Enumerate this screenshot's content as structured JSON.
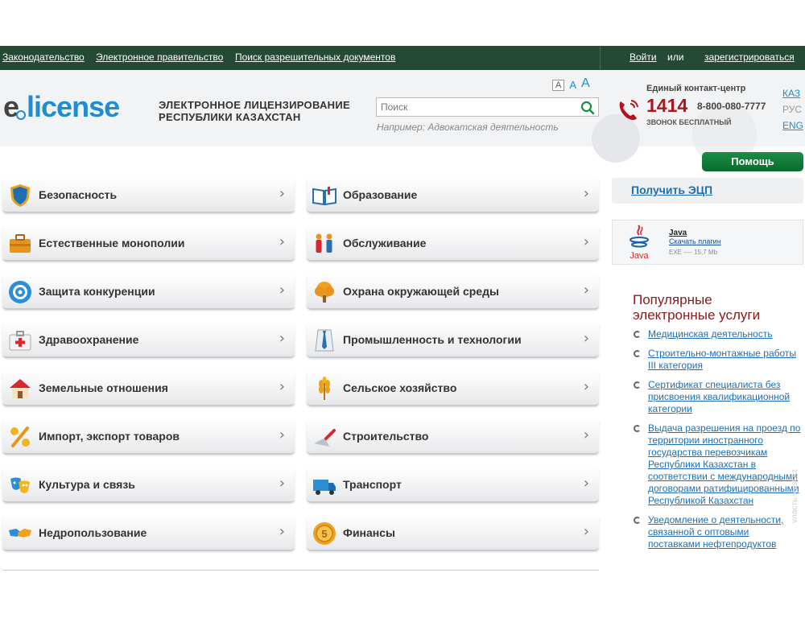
{
  "topnav": {
    "legislation": "Законодательство",
    "egov": "Электронное правительство",
    "permits_search": "Поиск разрешительных документов",
    "login": "Войти",
    "or": "или",
    "register": "зарегистрироваться"
  },
  "header": {
    "logo_e": "e",
    "logo_rest": "license",
    "tagline_line1": "ЭЛЕКТРОННОЕ ЛИЦЕНЗИРОВАНИЕ",
    "tagline_line2": "РЕСПУБЛИКИ КАЗАХСТАН",
    "font_sizes": [
      "A",
      "A",
      "A"
    ],
    "search_placeholder": "Поиск",
    "search_example": "Например: Адвокатская деятельность"
  },
  "contact": {
    "title": "Единый контакт-центр",
    "short_number": "1414",
    "long_number": "8-800-080-7777",
    "free_call": "ЗВОНОК БЕСПЛАТНЫЙ"
  },
  "languages": [
    "КАЗ",
    "РУС",
    "ENG"
  ],
  "active_language": "РУС",
  "help_button": "Помощь",
  "categories_left": [
    {
      "label": "Безопасность",
      "icon": "shield-icon"
    },
    {
      "label": "Естественные монополии",
      "icon": "briefcase-icon"
    },
    {
      "label": "Защита конкуренции",
      "icon": "target-icon"
    },
    {
      "label": "Здравоохранение",
      "icon": "first-aid-kit-icon"
    },
    {
      "label": "Земельные отношения",
      "icon": "house-icon"
    },
    {
      "label": "Импорт, экспорт товаров",
      "icon": "percent-icon"
    },
    {
      "label": "Культура и связь",
      "icon": "theater-masks-icon"
    },
    {
      "label": "Недропользование",
      "icon": "handshake-icon"
    }
  ],
  "categories_right": [
    {
      "label": "Образование",
      "icon": "book-icon"
    },
    {
      "label": "Обслуживание",
      "icon": "people-icon"
    },
    {
      "label": "Охрана окружающей среды",
      "icon": "tree-icon"
    },
    {
      "label": "Промышленность и технологии",
      "icon": "shirt-tie-icon"
    },
    {
      "label": "Сельское хозяйство",
      "icon": "wheat-icon"
    },
    {
      "label": "Строительство",
      "icon": "trowel-icon"
    },
    {
      "label": "Транспорт",
      "icon": "truck-icon"
    },
    {
      "label": "Финансы",
      "icon": "coin-icon"
    }
  ],
  "sidebar": {
    "get_ecp": "Получить ЭЦП",
    "java_title": "Java",
    "java_logo_text": "Java",
    "java_download": "Скачать плагин",
    "java_info": "EXE  ----  15,7 Mb",
    "popular_title_line1": "Популярные",
    "popular_title_line2": "электронные услуги",
    "popular": [
      "Медицинская деятельность",
      "Строительно-монтажные работы III категория",
      "Сертификат специалиста без присвоения квалификационной категории",
      "Выдача разрешения на проезд по территории иностранного государства перевозчикам Республики Казахстан в соответствии с международными договорами ратифицированными Республикой Казахстан",
      "Уведомление о деятельности, связанной с оптовыми поставками нефтепродуктов"
    ]
  },
  "watermark": "vласть   vlast.kz",
  "colors": {
    "topbar": "#244a36",
    "accent_blue": "#1f8dd0",
    "phone_red": "#b3121e",
    "help_green": "#0b6a2e",
    "popular_title": "#8a1a1a"
  }
}
